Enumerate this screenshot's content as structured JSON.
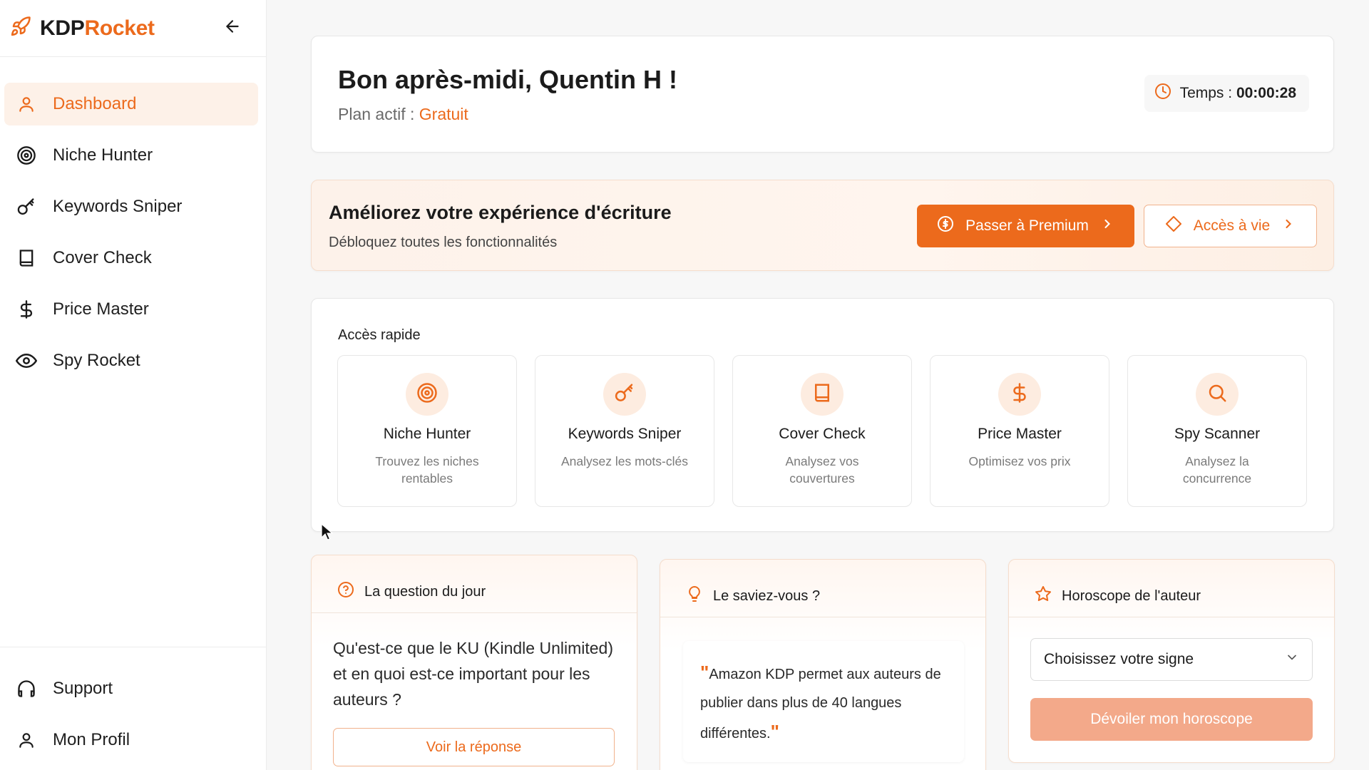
{
  "brand": {
    "part1": "KDP",
    "part2": "Rocket"
  },
  "colors": {
    "accent": "#ec6a1c",
    "accent_light": "#fdece0",
    "disabled_accent": "#f3a98a"
  },
  "sidebar": {
    "items": [
      {
        "label": "Dashboard",
        "icon": "user-icon",
        "active": true
      },
      {
        "label": "Niche Hunter",
        "icon": "target-icon"
      },
      {
        "label": "Keywords Sniper",
        "icon": "key-icon"
      },
      {
        "label": "Cover Check",
        "icon": "book-icon"
      },
      {
        "label": "Price Master",
        "icon": "dollar-icon"
      },
      {
        "label": "Spy Rocket",
        "icon": "eye-icon"
      }
    ],
    "bottom": [
      {
        "label": "Support",
        "icon": "headphones-icon"
      },
      {
        "label": "Mon Profil",
        "icon": "user-icon"
      }
    ]
  },
  "greeting": {
    "title": "Bon après-midi, Quentin H !",
    "plan_label": "Plan actif : ",
    "plan_value": "Gratuit",
    "timer_label": "Temps : ",
    "timer_value": "00:00:28"
  },
  "upgrade": {
    "title": "Améliorez votre expérience d'écriture",
    "subtitle": "Débloquez toutes les fonctionnalités",
    "premium_label": "Passer à Premium",
    "lifetime_label": "Accès à vie"
  },
  "quick_access": {
    "title": "Accès rapide",
    "tiles": [
      {
        "name": "Niche Hunter",
        "desc": "Trouvez les niches rentables",
        "icon": "target-icon"
      },
      {
        "name": "Keywords Sniper",
        "desc": "Analysez les mots-clés",
        "icon": "key-icon"
      },
      {
        "name": "Cover Check",
        "desc": "Analysez vos couvertures",
        "icon": "book-icon"
      },
      {
        "name": "Price Master",
        "desc": "Optimisez vos prix",
        "icon": "dollar-icon"
      },
      {
        "name": "Spy Scanner",
        "desc": "Analysez la concurrence",
        "icon": "search-icon"
      }
    ]
  },
  "question": {
    "title": "La question du jour",
    "text": "Qu'est-ce que le KU (Kindle Unlimited) et en quoi est-ce important pour les auteurs ?",
    "button": "Voir la réponse"
  },
  "fact": {
    "title": "Le saviez-vous ?",
    "text": "Amazon KDP permet aux auteurs de publier dans plus de 40 langues différentes."
  },
  "horoscope": {
    "title": "Horoscope de l'auteur",
    "select_value": "Choisissez votre signe",
    "button": "Dévoiler mon horoscope"
  }
}
